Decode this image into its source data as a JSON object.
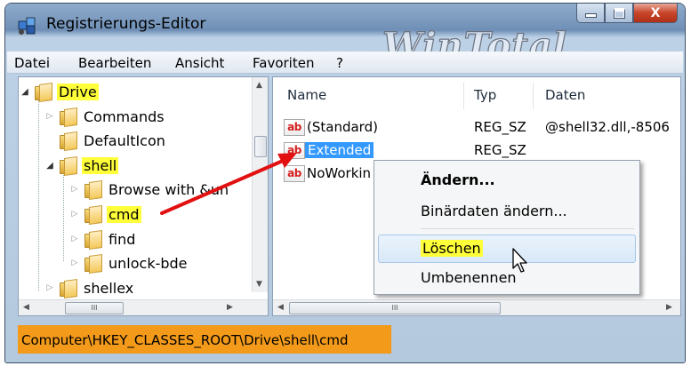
{
  "window": {
    "title": "Registrierungs-Editor",
    "watermark": "WinTotal",
    "controls": {
      "minimize": "–",
      "maximize": "□",
      "close": "X"
    }
  },
  "menu": [
    "Datei",
    "Bearbeiten",
    "Ansicht",
    "Favoriten",
    "?"
  ],
  "tree": {
    "items": [
      {
        "label": "Drive",
        "expanded": true,
        "highlighted": true
      },
      {
        "label": "Commands",
        "expanded": false,
        "highlighted": false
      },
      {
        "label": "DefaultIcon",
        "expanded": null,
        "highlighted": false
      },
      {
        "label": "shell",
        "expanded": true,
        "highlighted": true
      },
      {
        "label": "Browse with &un",
        "expanded": false,
        "highlighted": false
      },
      {
        "label": "cmd",
        "expanded": false,
        "highlighted": true
      },
      {
        "label": "find",
        "expanded": false,
        "highlighted": false
      },
      {
        "label": "unlock-bde",
        "expanded": false,
        "highlighted": false
      },
      {
        "label": "shellex",
        "expanded": false,
        "highlighted": false
      }
    ],
    "hscroll_thumb_label": "III"
  },
  "list": {
    "columns": [
      "Name",
      "Typ",
      "Daten"
    ],
    "rows": [
      {
        "icon": "ab",
        "name": "(Standard)",
        "type": "REG_SZ",
        "data": "@shell32.dll,-8506",
        "selected": false
      },
      {
        "icon": "ab",
        "name": "Extended",
        "type": "REG_SZ",
        "data": "",
        "selected": true
      },
      {
        "icon": "ab",
        "name": "NoWorkin",
        "type": "",
        "data": "",
        "selected": false
      }
    ],
    "hscroll_thumb_label": "III"
  },
  "context_menu": {
    "items": [
      {
        "label": "Ändern...",
        "bold": true
      },
      {
        "label": "Binärdaten ändern...",
        "bold": false
      },
      {
        "label": "Löschen",
        "bold": false,
        "hovered": true,
        "highlighted": true
      },
      {
        "label": "Umbenennen",
        "bold": false
      }
    ]
  },
  "status": {
    "path": "Computer\\HKEY_CLASSES_ROOT\\Drive\\shell\\cmd"
  },
  "colors": {
    "highlight": "#ffff3a",
    "status_bg": "#f39a1a",
    "selection": "#3399ff",
    "annotation_arrow": "#e21010"
  }
}
